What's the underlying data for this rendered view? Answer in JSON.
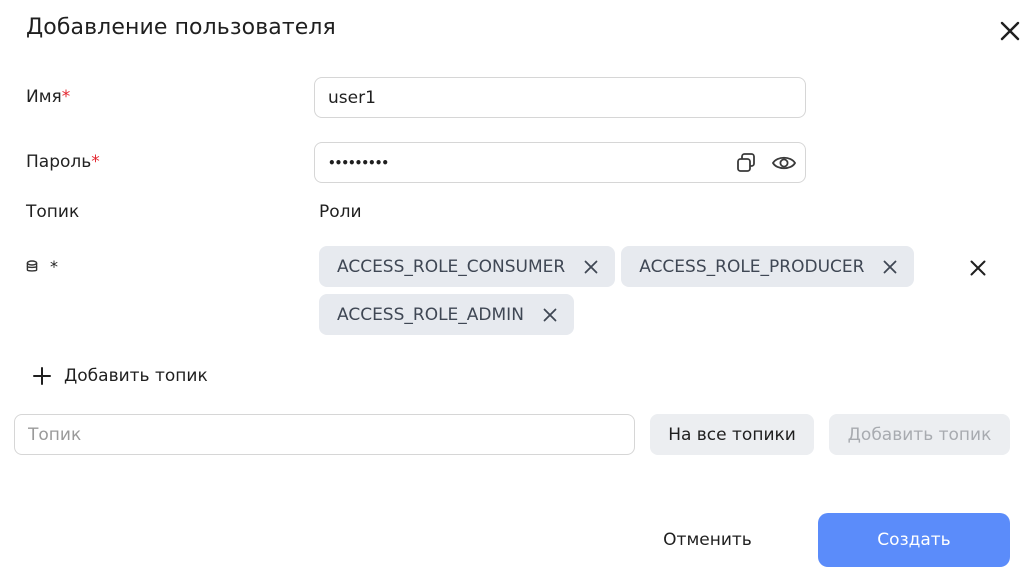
{
  "dialog": {
    "title": "Добавление пользователя"
  },
  "form": {
    "name_label": "Имя",
    "name_value": "user1",
    "password_label": "Пароль",
    "password_masked": "•••••••••",
    "required_mark": "*"
  },
  "permissions": {
    "topic_header": "Топик",
    "roles_header": "Роли",
    "rows": [
      {
        "topic": "*",
        "roles": [
          "ACCESS_ROLE_CONSUMER",
          "ACCESS_ROLE_PRODUCER",
          "ACCESS_ROLE_ADMIN"
        ]
      }
    ]
  },
  "add_topic": {
    "link_label": "Добавить топик",
    "input_placeholder": "Топик",
    "all_topics_button": "На все топики",
    "add_button": "Добавить топик"
  },
  "footer": {
    "cancel_label": "Отменить",
    "create_label": "Создать"
  },
  "colors": {
    "primary": "#5b8cfa",
    "chip_bg": "#e7eaef",
    "required": "#e3262f"
  }
}
